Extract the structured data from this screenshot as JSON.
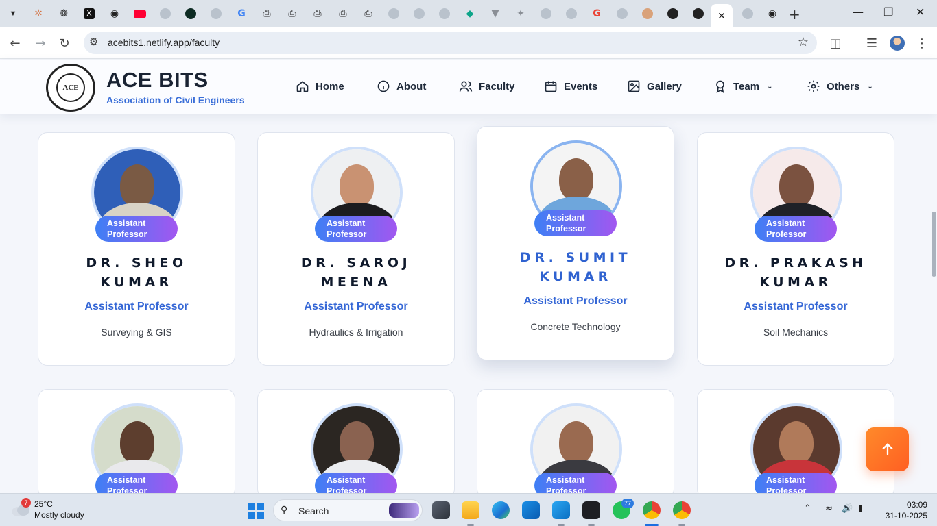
{
  "browser": {
    "url": "acebits1.netlify.app/faculty",
    "tab_favicons": [
      "claude-icon",
      "chatgpt-icon",
      "x-icon",
      "chrome-icon",
      "youtube-icon",
      "globe-icon",
      "perplexity-icon",
      "globe-icon",
      "google-icon",
      "gamma-icon",
      "gamma-icon",
      "gamma-icon",
      "gamma-icon",
      "gamma-icon",
      "globe-icon",
      "globe-icon",
      "globe-icon",
      "diamond-icon",
      "vercel-icon",
      "sparkle-icon",
      "globe-icon",
      "globe-icon",
      "google-icon",
      "globe-icon",
      "avatar-icon",
      "github-icon",
      "github-icon"
    ],
    "active_tab_close": "✕",
    "new_tab": "+"
  },
  "site": {
    "logo_text": "ACE",
    "title": "ACE BITS",
    "subtitle": "Association of Civil Engineers",
    "nav": [
      {
        "label": "Home",
        "icon": "home-icon"
      },
      {
        "label": "About",
        "icon": "info-icon"
      },
      {
        "label": "Faculty",
        "icon": "users-icon"
      },
      {
        "label": "Events",
        "icon": "calendar-icon"
      },
      {
        "label": "Gallery",
        "icon": "image-icon"
      },
      {
        "label": "Team",
        "icon": "award-icon",
        "dropdown": true
      },
      {
        "label": "Others",
        "icon": "gear-icon",
        "dropdown": true
      }
    ]
  },
  "faculty": [
    {
      "badge_line1": "Assistant",
      "badge_line2": "Professor",
      "name_line1": "DR. SHEO",
      "name_line2": "KUMAR",
      "role": "Assistant Professor",
      "subject": "Surveying & GIS"
    },
    {
      "badge_line1": "Assistant",
      "badge_line2": "Professor",
      "name_line1": "DR. SAROJ",
      "name_line2": "MEENA",
      "role": "Assistant Professor",
      "subject": "Hydraulics & Irrigation"
    },
    {
      "badge_line1": "Assistant",
      "badge_line2": "Professor",
      "name_line1": "DR. SUMIT",
      "name_line2": "KUMAR",
      "role": "Assistant Professor",
      "subject": "Concrete Technology"
    },
    {
      "badge_line1": "Assistant",
      "badge_line2": "Professor",
      "name_line1": "DR. PRAKASH",
      "name_line2": "KUMAR",
      "role": "Assistant Professor",
      "subject": "Soil Mechanics"
    },
    {
      "badge_line1": "Assistant",
      "badge_line2": "Professor"
    },
    {
      "badge_line1": "Assistant",
      "badge_line2": "Professor"
    },
    {
      "badge_line1": "Assistant",
      "badge_line2": "Professor"
    },
    {
      "badge_line1": "Assistant",
      "badge_line2": "Professor"
    }
  ],
  "scroll_to_top_icon": "arrow-up-icon",
  "taskbar": {
    "weather_alert_count": "7",
    "temperature": "25°C",
    "weather": "Mostly cloudy",
    "search_label": "Search",
    "whatsapp_badge": "77",
    "time": "03:09",
    "date": "31-10-2025",
    "apps": [
      "file-manager-icon",
      "file-explorer-icon",
      "edge-icon",
      "outlook-icon",
      "vscode-icon",
      "app-icon",
      "whatsapp-icon",
      "chrome-icon",
      "chrome-profile-icon"
    ]
  }
}
